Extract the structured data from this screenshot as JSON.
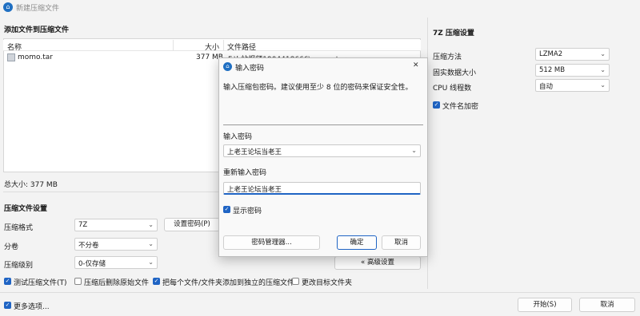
{
  "window": {
    "title": "新建压缩文件",
    "icon": "archive-app-icon"
  },
  "files": {
    "section_title": "添加文件到压缩文件",
    "columns": [
      "名称",
      "大小",
      "文件路径"
    ],
    "rows": [
      {
        "name": "momo.tar",
        "size": "377 MB",
        "path": "F:\\b站视频1904418666\\momo.tar"
      }
    ],
    "total": "总大小: 377 MB"
  },
  "compress": {
    "section_title": "压缩文件设置",
    "format_label": "压缩格式",
    "format_value": "7Z",
    "split_label": "分卷",
    "split_value": "不分卷",
    "level_label": "压缩级别",
    "level_value": "0-仅存储",
    "set_password_button": "设置密码(P)",
    "advanced_button": "« 高级设置"
  },
  "options": {
    "test": {
      "label": "测试压缩文件(T)",
      "checked": true
    },
    "delete": {
      "label": "压缩后删除原始文件",
      "checked": false
    },
    "separate": {
      "label": "把每个文件/文件夹添加到独立的压缩文件",
      "checked": true
    },
    "change_target": {
      "label": "更改目标文件夹",
      "checked": false
    },
    "more": {
      "label": "更多选项...",
      "checked": true
    }
  },
  "footer": {
    "start_button": "开始(S)",
    "cancel_button": "取消"
  },
  "seven_z": {
    "section_title": "7Z 压缩设置",
    "method_label": "压缩方法",
    "method_value": "LZMA2",
    "dict_label": "固实数据大小",
    "dict_value": "512 MB",
    "threads_label": "CPU 线程数",
    "threads_value": "自动",
    "encrypt_names": {
      "label": "文件名加密",
      "checked": true
    }
  },
  "dialog": {
    "title": "输入密码",
    "info": "输入压缩包密码。建议使用至少 8 位的密码来保证安全性。",
    "password_label": "输入密码",
    "password_value": "上老王论坛当老王",
    "reenter_label": "重新输入密码",
    "reenter_value": "上老王论坛当老王",
    "show_password": {
      "label": "显示密码",
      "checked": true
    },
    "manager_button": "密码管理器...",
    "ok_button": "确定",
    "cancel_button": "取消",
    "close_glyph": "✕"
  },
  "colors": {
    "accent": "#1f64c4",
    "background": "#f3f3f3"
  }
}
